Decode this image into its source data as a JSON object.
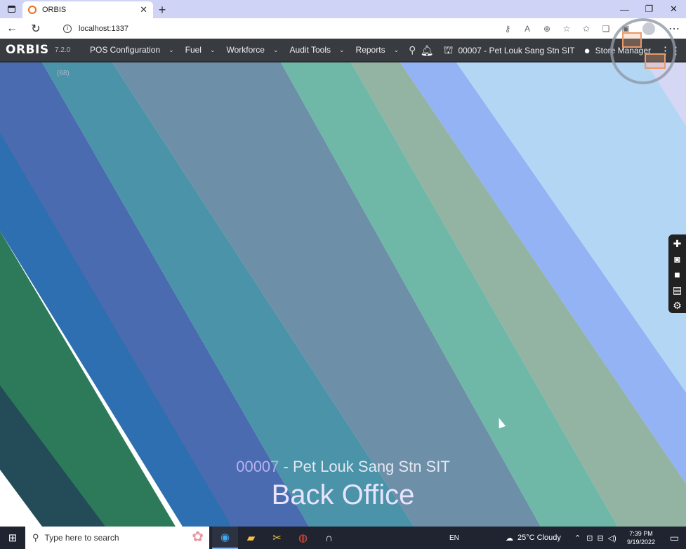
{
  "browser": {
    "tab_title": "ORBIS",
    "tab_close": "✕",
    "new_tab": "+",
    "url": "localhost:1337",
    "window_controls": [
      "—",
      "❐",
      "✕"
    ]
  },
  "app": {
    "logo": "ORBIS",
    "version": "7.2.0",
    "menu": [
      {
        "label": "POS Configuration"
      },
      {
        "label": "Fuel"
      },
      {
        "label": "Workforce"
      },
      {
        "label": "Audit Tools"
      },
      {
        "label": "Reports"
      }
    ],
    "store": "00007 - Pet Louk Sang Stn SIT",
    "user": "Store Manager"
  },
  "main": {
    "badge": "(68)",
    "store_number": "00007",
    "store_name": " - Pet Louk Sang Stn SIT",
    "title": "Back Office"
  },
  "taskbar": {
    "search_placeholder": "Type here to search",
    "lang": "EN",
    "weather": "25°C  Cloudy",
    "time": "7:39 PM",
    "date": "9/19/2022"
  },
  "colors": {
    "navbar": "#383b40",
    "stripe_dark_teal": "#0d4a52",
    "stripe_green": "#2d7a5a",
    "stripe_blue": "#2d6fb0",
    "stripe_indigo": "#4a6bb0",
    "stripe_teal": "#4a93a8",
    "stripe_slate": "#6e8fa8",
    "stripe_mint": "#6fb8a8",
    "stripe_sage": "#93b3a3",
    "stripe_periwinkle": "#93b3f5",
    "stripe_sky": "#b3d6f5",
    "stripe_lavender": "#d6d6f5",
    "stripe_violet": "#b0a8e8"
  }
}
